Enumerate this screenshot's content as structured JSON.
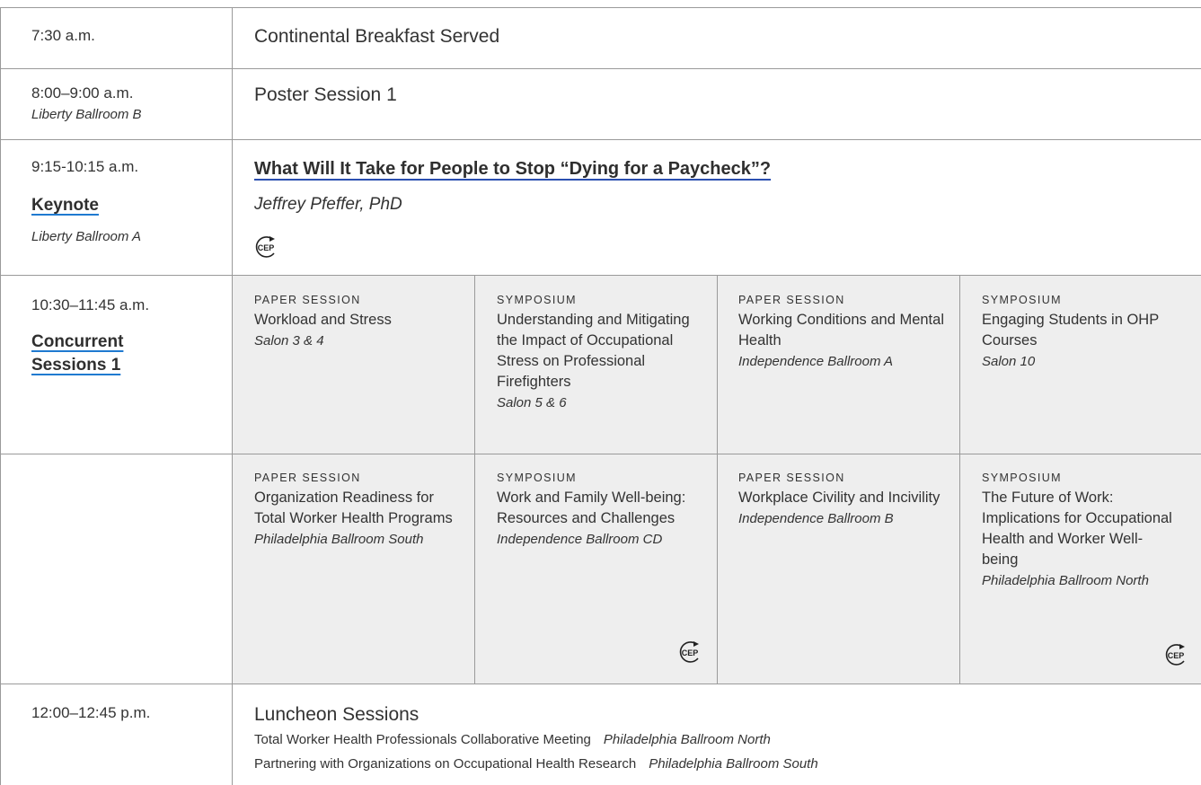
{
  "rows": {
    "r1": {
      "time": "7:30 a.m.",
      "title": "Continental Breakfast Served"
    },
    "r2": {
      "time": "8:00–9:00 a.m.",
      "room": "Liberty Ballroom B",
      "title": "Poster Session 1"
    },
    "r3": {
      "time": "9:15-10:15 a.m.",
      "label": "Keynote",
      "room": "Liberty Ballroom A",
      "title": "What Will It Take for People to Stop “Dying for a Paycheck”?",
      "speaker": "Jeffrey Pfeffer, PhD"
    },
    "r4": {
      "time": "10:30–11:45 a.m.",
      "label_line1": "Concurrent",
      "label_line2": "Sessions 1"
    },
    "r6": {
      "time": "12:00–12:45 p.m.",
      "title": "Luncheon Sessions"
    }
  },
  "sessions_a": [
    {
      "kind": "PAPER SESSION",
      "title": "Workload and Stress",
      "room": "Salon 3 & 4"
    },
    {
      "kind": "SYMPOSIUM",
      "title": "Understanding and Mitigating the Impact of Occupational Stress on Professional Firefighters",
      "room": "Salon 5 & 6"
    },
    {
      "kind": "PAPER SESSION",
      "title": "Working Conditions and Mental Health",
      "room": "Independence Ballroom A"
    },
    {
      "kind": "SYMPOSIUM",
      "title": "Engaging Students in OHP Courses",
      "room": "Salon 10"
    }
  ],
  "sessions_b": [
    {
      "kind": "PAPER SESSION",
      "title": "Organization Readiness for Total Worker Health Programs",
      "room": "Philadelphia Ballroom South"
    },
    {
      "kind": "SYMPOSIUM",
      "title": "Work and Family Well-being: Resources and Challenges",
      "room": "Independence Ballroom CD"
    },
    {
      "kind": "PAPER SESSION",
      "title": "Workplace Civility and Incivility",
      "room": "Independence Ballroom B"
    },
    {
      "kind": "SYMPOSIUM",
      "title": "The Future of Work: Implications for Occupational Health and Worker Well-being",
      "room": "Philadelphia Ballroom North"
    }
  ],
  "lunch_items": [
    {
      "title": "Total Worker Health Professionals Collaborative Meeting",
      "room": "Philadelphia Ballroom North"
    },
    {
      "title": "Partnering with Organizations on Occupational Health Research",
      "room": "Philadelphia Ballroom South"
    }
  ],
  "cep_badge": "CEP",
  "colors": {
    "grid": "#9a9a9a",
    "shade": "#eeeeee",
    "link_underline": "#1f7ad0",
    "text": "#333333"
  }
}
